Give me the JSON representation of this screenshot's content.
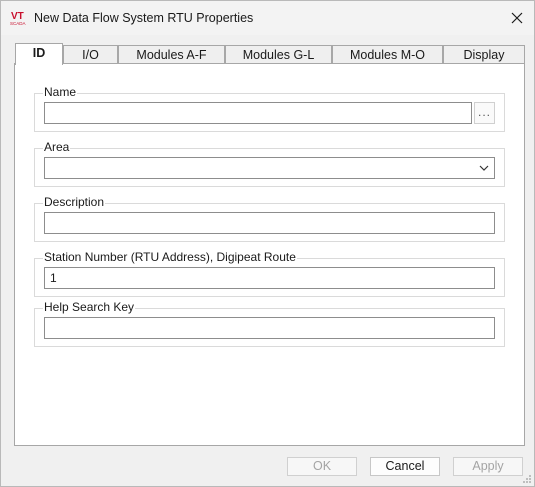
{
  "window": {
    "title": "New Data Flow System RTU Properties",
    "icon_text_top": "VT",
    "icon_text_bottom": "SCADA"
  },
  "tabs": [
    {
      "label": "ID",
      "active": true
    },
    {
      "label": "I/O",
      "active": false
    },
    {
      "label": "Modules A-F",
      "active": false
    },
    {
      "label": "Modules G-L",
      "active": false
    },
    {
      "label": "Modules M-O",
      "active": false
    },
    {
      "label": "Display",
      "active": false
    }
  ],
  "fields": {
    "name": {
      "label": "Name",
      "value": "",
      "browse_label": "..."
    },
    "area": {
      "label": "Area",
      "value": ""
    },
    "description": {
      "label": "Description",
      "value": ""
    },
    "station_number": {
      "label": "Station Number (RTU Address), Digipeat Route",
      "value": "1"
    },
    "help_search_key": {
      "label": "Help Search Key",
      "value": ""
    }
  },
  "buttons": {
    "ok": {
      "label": "OK",
      "enabled": false
    },
    "cancel": {
      "label": "Cancel",
      "enabled": true
    },
    "apply": {
      "label": "Apply",
      "enabled": false
    }
  },
  "colors": {
    "brand_red": "#c8102e",
    "panel_bg": "#ffffff",
    "window_bg": "#f0f0f0"
  }
}
